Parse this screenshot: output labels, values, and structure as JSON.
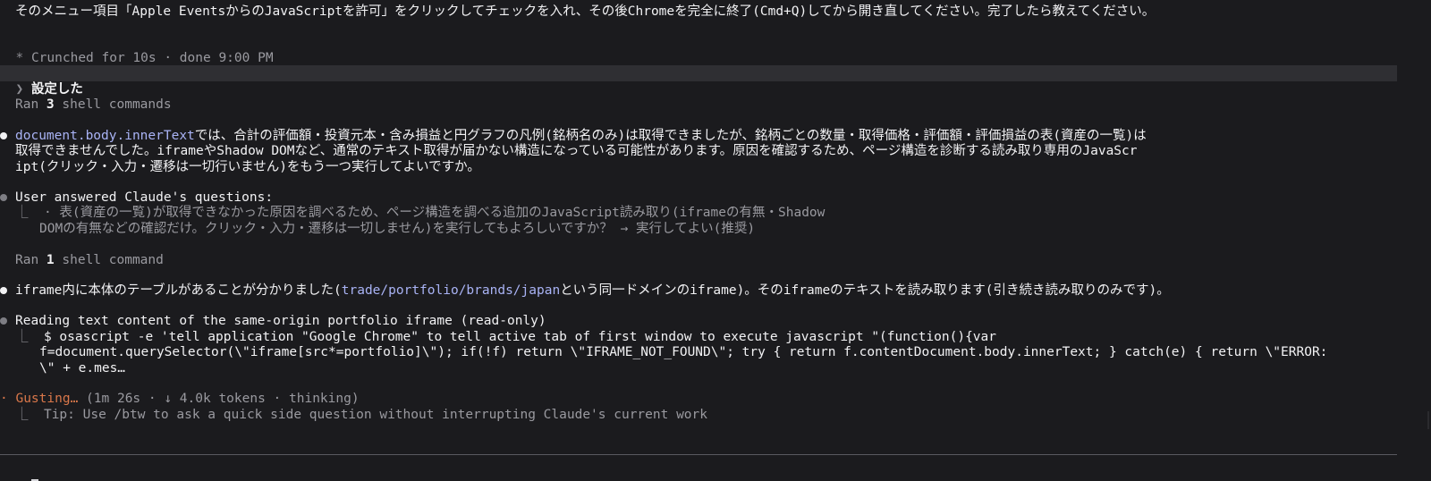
{
  "top_line": "そのメニュー項目「Apple EventsからのJavaScriptを許可」をクリックしてチェックを入れ、その後Chromeを完全に終了(Cmd+Q)してから開き直してください。完了したら教えてください。",
  "crunched": {
    "glyph": "*",
    "text": "Crunched for 10s · done 9:00 PM"
  },
  "user_prompt": {
    "glyph": "❯",
    "text": "設定した"
  },
  "ran1": {
    "prefix": "Ran ",
    "count": "3",
    "suffix": " shell commands"
  },
  "message1": {
    "link": "document.body.innerText",
    "line1_rest": "では、合計の評価額・投資元本・含み損益と円グラフの凡例(銘柄名のみ)は取得できましたが、銘柄ごとの数量・取得価格・評価額・評価損益の表(資産の一覧)は",
    "line2": "取得できませんでした。iframeやShadow DOMなど、通常のテキスト取得が届かない構造になっている可能性があります。原因を確認するため、ページ構造を診断する読み取り専用のJavaScr",
    "line3": "ipt(クリック・入力・遷移は一切行いません)をもう一つ実行してよいですか。"
  },
  "answered": {
    "title": "User answered Claude's questions:",
    "branch": "⎿",
    "line1": "· 表(資産の一覧)が取得できなかった原因を調べるため、ページ構造を調べる追加のJavaScript読み取り(iframeの有無・Shadow",
    "line2": "DOMの有無などの確認だけ。クリック・入力・遷移は一切しません)を実行してもよろしいですか？ → 実行してよい(推奨)"
  },
  "ran2": {
    "prefix": "Ran ",
    "count": "1",
    "suffix": " shell command"
  },
  "message2": {
    "before": "iframe内に本体のテーブルがあることが分かりました(",
    "link": "trade/portfolio/brands/japan",
    "after": "という同一ドメインのiframe)。そのiframeのテキストを読み取ります(引き続き読み取りのみです)。"
  },
  "reading": {
    "title": "Reading text content of the same-origin portfolio iframe (read-only)",
    "branch": "⎿",
    "line1": "$ osascript -e 'tell application \"Google Chrome\" to tell active tab of first window to execute javascript \"(function(){var",
    "line2": "f=document.querySelector(\\\"iframe[src*=portfolio]\\\"); if(!f) return \\\"IFRAME_NOT_FOUND\\\"; try { return f.contentDocument.body.innerText; } catch(e) { return \\\"ERROR:",
    "line3": "\\\" + e.mes…"
  },
  "status": {
    "glyph": "·",
    "word": "Gusting…",
    "detail": " (1m 26s · ↓ 4.0k tokens · thinking)",
    "branch": "⎿",
    "tip": "Tip: Use /btw to ask a quick side question without interrupting Claude's current work"
  },
  "input": {
    "glyph": "❯"
  }
}
